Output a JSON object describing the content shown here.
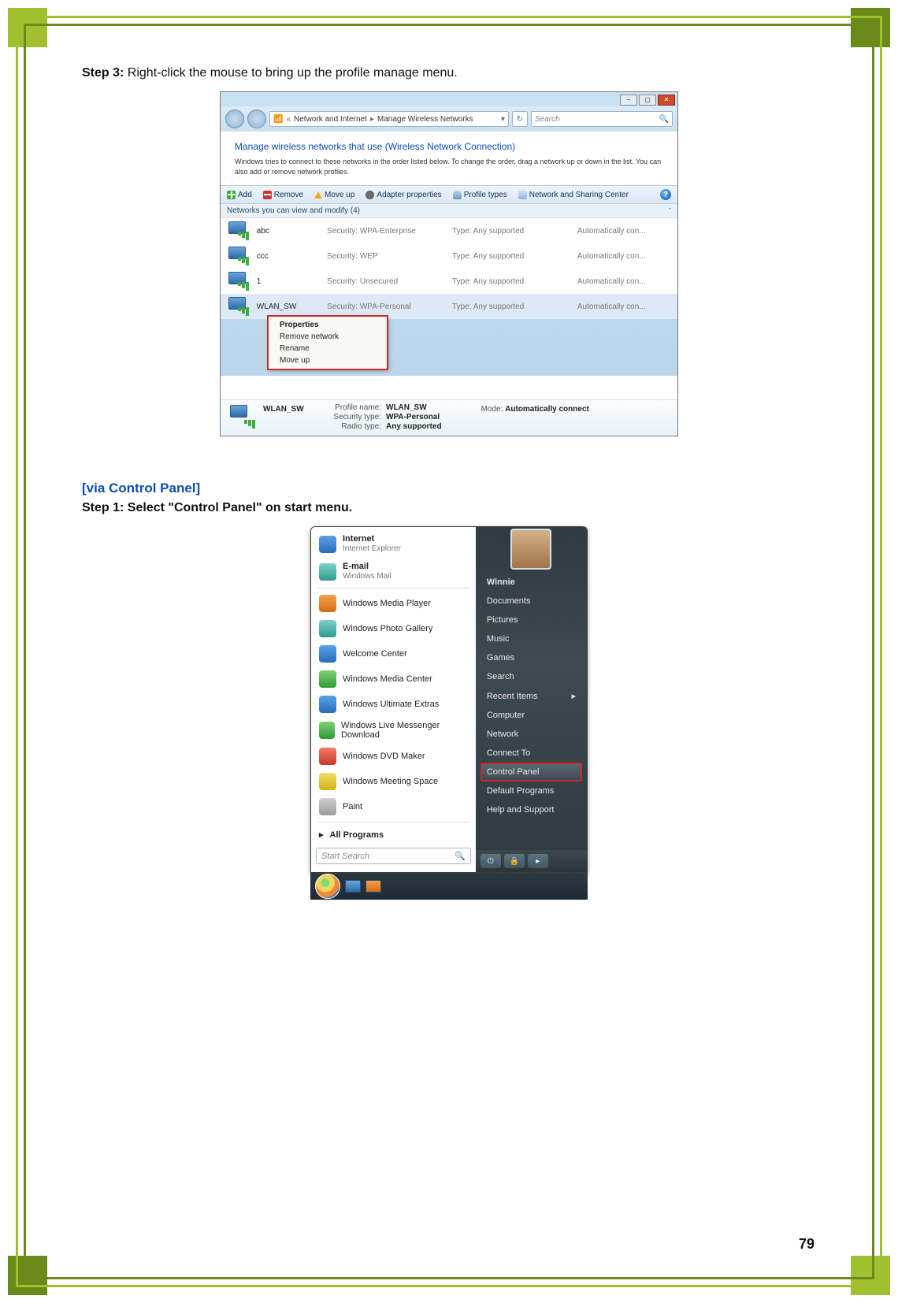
{
  "step3": {
    "label": "Step 3:",
    "text": " Right-click the mouse to bring up the profile manage menu."
  },
  "section_heading": "[via Control Panel]",
  "step1": "Step 1: Select \"Control Panel\" on start menu.",
  "page_number": "79",
  "mwn": {
    "breadcrumb": {
      "prefix": "«",
      "seg1": "Network and Internet",
      "seg2": "Manage Wireless Networks"
    },
    "search_placeholder": "Search",
    "heading": "Manage wireless networks that use (Wireless Network Connection)",
    "subtext": "Windows tries to connect to these networks in the order listed below. To change the order, drag a network up or down in the list. You can also add or remove network profiles.",
    "toolbar": {
      "add": "Add",
      "remove": "Remove",
      "moveup": "Move up",
      "adapter": "Adapter properties",
      "profile": "Profile types",
      "center": "Network and Sharing Center"
    },
    "group_header": "Networks you can view and modify (4)",
    "rows": [
      {
        "name": "abc",
        "security": "Security: WPA-Enterprise",
        "type": "Type: Any supported",
        "auto": "Automatically con..."
      },
      {
        "name": "ccc",
        "security": "Security: WEP",
        "type": "Type: Any supported",
        "auto": "Automatically con..."
      },
      {
        "name": "1",
        "security": "Security: Unsecured",
        "type": "Type: Any supported",
        "auto": "Automatically con..."
      },
      {
        "name": "WLAN_SW",
        "security": "Security: WPA-Personal",
        "type": "Type: Any supported",
        "auto": "Automatically con..."
      }
    ],
    "context": {
      "props": "Properties",
      "remove": "Remove network",
      "rename": "Rename",
      "moveup": "Move up"
    },
    "details": {
      "name": "WLAN_SW",
      "k_profile": "Profile name:",
      "v_profile": "WLAN_SW",
      "k_sec": "Security type:",
      "v_sec": "WPA-Personal",
      "k_radio": "Radio type:",
      "v_radio": "Any supported",
      "k_mode": "Mode:",
      "v_mode": "Automatically connect"
    }
  },
  "startmenu": {
    "left_top": [
      {
        "title": "Internet",
        "sub": "Internet Explorer",
        "bg": "bg-blue"
      },
      {
        "title": "E-mail",
        "sub": "Windows Mail",
        "bg": "bg-teal"
      }
    ],
    "left_items": [
      {
        "title": "Windows Media Player",
        "bg": "bg-orange"
      },
      {
        "title": "Windows Photo Gallery",
        "bg": "bg-teal"
      },
      {
        "title": "Welcome Center",
        "bg": "bg-blue"
      },
      {
        "title": "Windows Media Center",
        "bg": "bg-green"
      },
      {
        "title": "Windows Ultimate Extras",
        "bg": "bg-blue"
      },
      {
        "title": "Windows Live Messenger Download",
        "bg": "bg-green"
      },
      {
        "title": "Windows DVD Maker",
        "bg": "bg-red"
      },
      {
        "title": "Windows Meeting Space",
        "bg": "bg-yellow"
      },
      {
        "title": "Paint",
        "bg": "bg-grey"
      }
    ],
    "all_programs": "All Programs",
    "search_placeholder": "Start Search",
    "right_user": "Winnie",
    "right_items": [
      "Documents",
      "Pictures",
      "Music",
      "Games",
      "Search",
      "Recent Items",
      "Computer",
      "Network",
      "Connect To",
      "Control Panel",
      "Default Programs",
      "Help and Support"
    ],
    "highlight_index": 9
  }
}
